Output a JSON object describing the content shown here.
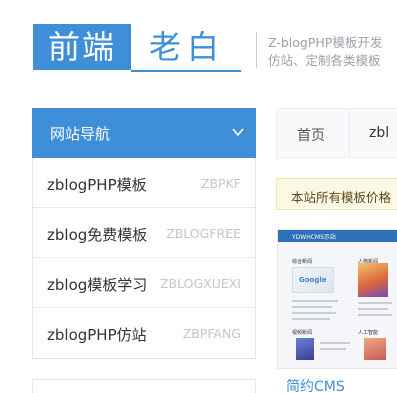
{
  "logo": {
    "left": "前端",
    "right": "老白"
  },
  "tagline": [
    "Z-blogPHP模板开发",
    "仿站、定制各类模板"
  ],
  "sidebar": {
    "title": "网站导航",
    "items": [
      {
        "name": "zblogPHP模板",
        "code": "ZBPKF"
      },
      {
        "name": "zblog免费模板",
        "code": "ZBLOGFREE"
      },
      {
        "name": "zblog模板学习",
        "code": "ZBLOGXUEXI"
      },
      {
        "name": "zblogPHP仿站",
        "code": "ZBPFANG"
      }
    ]
  },
  "nav": {
    "items": [
      "首页",
      "zbl"
    ]
  },
  "notice": "本站所有模板价格",
  "thumbnail": {
    "bar_text": "YDWHCMS示站",
    "col1_title": "综合新闻",
    "col2_title": "人物新闻",
    "col3_title": "视频新闻",
    "col4_title": "人工智能",
    "img_text": "Google",
    "caption": "简约CMS"
  },
  "colors": {
    "accent": "#3e8ed8",
    "notice_bg": "#fcf8e3"
  }
}
